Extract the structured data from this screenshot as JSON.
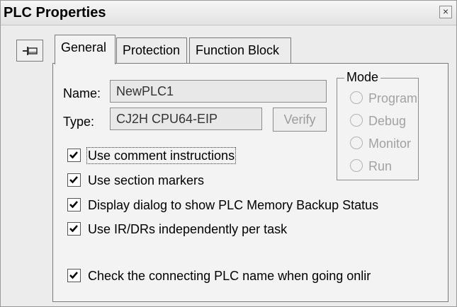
{
  "window": {
    "title": "PLC Properties",
    "close_glyph": "×"
  },
  "toolbar": {
    "pin_icon": "pin-icon"
  },
  "tabs": [
    {
      "label": "General",
      "active": true
    },
    {
      "label": "Protection",
      "active": false
    },
    {
      "label": "Function Block",
      "active": false
    }
  ],
  "general": {
    "name_label": "Name:",
    "name_value": "NewPLC1",
    "type_label": "Type:",
    "type_value": "CJ2H CPU64-EIP",
    "verify_label": "Verify",
    "mode": {
      "legend": "Mode",
      "options": [
        "Program",
        "Debug",
        "Monitor",
        "Run"
      ]
    },
    "checkboxes": [
      {
        "label": "Use comment instructions",
        "checked": true
      },
      {
        "label": "Use section markers",
        "checked": true
      },
      {
        "label": "Display dialog to show PLC Memory Backup Status",
        "checked": true
      },
      {
        "label": "Use IR/DRs independently per task",
        "checked": true
      },
      {
        "label": "Check the connecting PLC name when going onlir",
        "checked": true
      }
    ]
  }
}
